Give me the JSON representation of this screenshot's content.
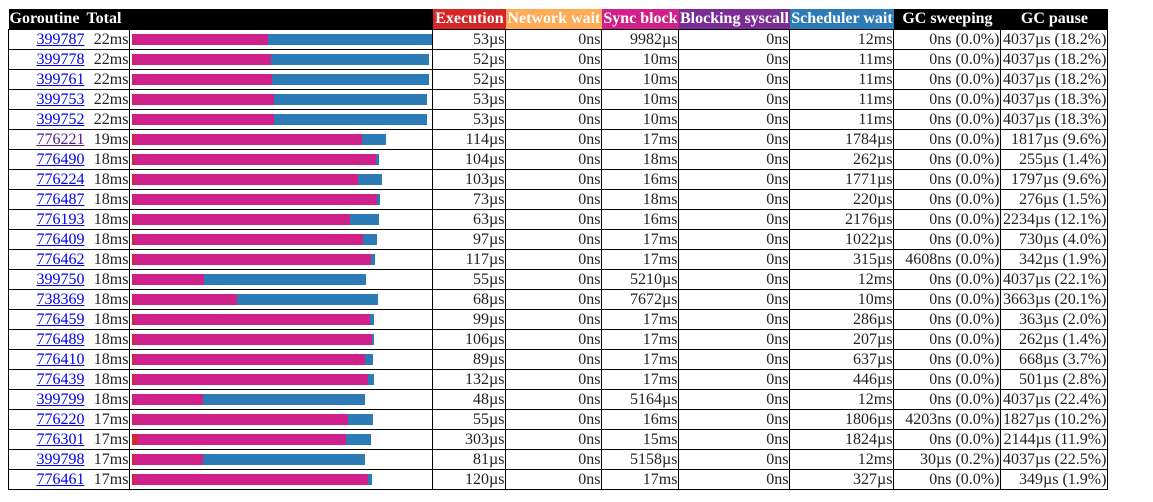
{
  "table": {
    "headers": {
      "goroutine": "Goroutine",
      "total": "Total",
      "execution": "Execution",
      "network_wait": "Network wait",
      "sync_block": "Sync block",
      "blocking_syscall": "Blocking syscall",
      "scheduler_wait": "Scheduler wait",
      "gc_sweeping": "GC sweeping",
      "gc_pause": "GC pause"
    },
    "colors": {
      "header_bg": "#000000",
      "execution": "#d62728",
      "network_wait": "#ffaa55",
      "sync_block": "#d0208a",
      "blocking_syscall": "#7b2d96",
      "scheduler_wait": "#2c7bb6",
      "link": "#0000ee",
      "link_visited": "#551a8b"
    },
    "rows": [
      {
        "id": "399787",
        "total": "22ms",
        "execution": "53µs",
        "network_wait": "0ns",
        "sync_block": "9982µs",
        "blocking_syscall": "0ns",
        "scheduler_wait": "12ms",
        "gc_sweeping": "0ns (0.0%)",
        "gc_pause": "4037µs (18.2%)",
        "visited": false
      },
      {
        "id": "399778",
        "total": "22ms",
        "execution": "52µs",
        "network_wait": "0ns",
        "sync_block": "10ms",
        "blocking_syscall": "0ns",
        "scheduler_wait": "11ms",
        "gc_sweeping": "0ns (0.0%)",
        "gc_pause": "4037µs (18.2%)",
        "visited": false
      },
      {
        "id": "399761",
        "total": "22ms",
        "execution": "52µs",
        "network_wait": "0ns",
        "sync_block": "10ms",
        "blocking_syscall": "0ns",
        "scheduler_wait": "11ms",
        "gc_sweeping": "0ns (0.0%)",
        "gc_pause": "4037µs (18.2%)",
        "visited": false
      },
      {
        "id": "399753",
        "total": "22ms",
        "execution": "53µs",
        "network_wait": "0ns",
        "sync_block": "10ms",
        "blocking_syscall": "0ns",
        "scheduler_wait": "11ms",
        "gc_sweeping": "0ns (0.0%)",
        "gc_pause": "4037µs (18.3%)",
        "visited": false
      },
      {
        "id": "399752",
        "total": "22ms",
        "execution": "53µs",
        "network_wait": "0ns",
        "sync_block": "10ms",
        "blocking_syscall": "0ns",
        "scheduler_wait": "11ms",
        "gc_sweeping": "0ns (0.0%)",
        "gc_pause": "4037µs (18.3%)",
        "visited": false
      },
      {
        "id": "776221",
        "total": "19ms",
        "execution": "114µs",
        "network_wait": "0ns",
        "sync_block": "17ms",
        "blocking_syscall": "0ns",
        "scheduler_wait": "1784µs",
        "gc_sweeping": "0ns (0.0%)",
        "gc_pause": "1817µs (9.6%)",
        "visited": true
      },
      {
        "id": "776490",
        "total": "18ms",
        "execution": "104µs",
        "network_wait": "0ns",
        "sync_block": "18ms",
        "blocking_syscall": "0ns",
        "scheduler_wait": "262µs",
        "gc_sweeping": "0ns (0.0%)",
        "gc_pause": "255µs (1.4%)",
        "visited": false
      },
      {
        "id": "776224",
        "total": "18ms",
        "execution": "103µs",
        "network_wait": "0ns",
        "sync_block": "16ms",
        "blocking_syscall": "0ns",
        "scheduler_wait": "1771µs",
        "gc_sweeping": "0ns (0.0%)",
        "gc_pause": "1797µs (9.6%)",
        "visited": false
      },
      {
        "id": "776487",
        "total": "18ms",
        "execution": "73µs",
        "network_wait": "0ns",
        "sync_block": "18ms",
        "blocking_syscall": "0ns",
        "scheduler_wait": "220µs",
        "gc_sweeping": "0ns (0.0%)",
        "gc_pause": "276µs (1.5%)",
        "visited": false
      },
      {
        "id": "776193",
        "total": "18ms",
        "execution": "63µs",
        "network_wait": "0ns",
        "sync_block": "16ms",
        "blocking_syscall": "0ns",
        "scheduler_wait": "2176µs",
        "gc_sweeping": "0ns (0.0%)",
        "gc_pause": "2234µs (12.1%)",
        "visited": false
      },
      {
        "id": "776409",
        "total": "18ms",
        "execution": "97µs",
        "network_wait": "0ns",
        "sync_block": "17ms",
        "blocking_syscall": "0ns",
        "scheduler_wait": "1022µs",
        "gc_sweeping": "0ns (0.0%)",
        "gc_pause": "730µs (4.0%)",
        "visited": false
      },
      {
        "id": "776462",
        "total": "18ms",
        "execution": "117µs",
        "network_wait": "0ns",
        "sync_block": "17ms",
        "blocking_syscall": "0ns",
        "scheduler_wait": "315µs",
        "gc_sweeping": "4608ns (0.0%)",
        "gc_pause": "342µs (1.9%)",
        "visited": false
      },
      {
        "id": "399750",
        "total": "18ms",
        "execution": "55µs",
        "network_wait": "0ns",
        "sync_block": "5210µs",
        "blocking_syscall": "0ns",
        "scheduler_wait": "12ms",
        "gc_sweeping": "0ns (0.0%)",
        "gc_pause": "4037µs (22.1%)",
        "visited": false
      },
      {
        "id": "738369",
        "total": "18ms",
        "execution": "68µs",
        "network_wait": "0ns",
        "sync_block": "7672µs",
        "blocking_syscall": "0ns",
        "scheduler_wait": "10ms",
        "gc_sweeping": "0ns (0.0%)",
        "gc_pause": "3663µs (20.1%)",
        "visited": false
      },
      {
        "id": "776459",
        "total": "18ms",
        "execution": "99µs",
        "network_wait": "0ns",
        "sync_block": "17ms",
        "blocking_syscall": "0ns",
        "scheduler_wait": "286µs",
        "gc_sweeping": "0ns (0.0%)",
        "gc_pause": "363µs (2.0%)",
        "visited": false
      },
      {
        "id": "776489",
        "total": "18ms",
        "execution": "106µs",
        "network_wait": "0ns",
        "sync_block": "17ms",
        "blocking_syscall": "0ns",
        "scheduler_wait": "207µs",
        "gc_sweeping": "0ns (0.0%)",
        "gc_pause": "262µs (1.4%)",
        "visited": false
      },
      {
        "id": "776410",
        "total": "18ms",
        "execution": "89µs",
        "network_wait": "0ns",
        "sync_block": "17ms",
        "blocking_syscall": "0ns",
        "scheduler_wait": "637µs",
        "gc_sweeping": "0ns (0.0%)",
        "gc_pause": "668µs (3.7%)",
        "visited": false
      },
      {
        "id": "776439",
        "total": "18ms",
        "execution": "132µs",
        "network_wait": "0ns",
        "sync_block": "17ms",
        "blocking_syscall": "0ns",
        "scheduler_wait": "446µs",
        "gc_sweeping": "0ns (0.0%)",
        "gc_pause": "501µs (2.8%)",
        "visited": false
      },
      {
        "id": "399799",
        "total": "18ms",
        "execution": "48µs",
        "network_wait": "0ns",
        "sync_block": "5164µs",
        "blocking_syscall": "0ns",
        "scheduler_wait": "12ms",
        "gc_sweeping": "0ns (0.0%)",
        "gc_pause": "4037µs (22.4%)",
        "visited": false
      },
      {
        "id": "776220",
        "total": "17ms",
        "execution": "55µs",
        "network_wait": "0ns",
        "sync_block": "16ms",
        "blocking_syscall": "0ns",
        "scheduler_wait": "1806µs",
        "gc_sweeping": "4203ns (0.0%)",
        "gc_pause": "1827µs (10.2%)",
        "visited": false
      },
      {
        "id": "776301",
        "total": "17ms",
        "execution": "303µs",
        "network_wait": "0ns",
        "sync_block": "15ms",
        "blocking_syscall": "0ns",
        "scheduler_wait": "1824µs",
        "gc_sweeping": "0ns (0.0%)",
        "gc_pause": "2144µs (11.9%)",
        "visited": false
      },
      {
        "id": "399798",
        "total": "17ms",
        "execution": "81µs",
        "network_wait": "0ns",
        "sync_block": "5158µs",
        "blocking_syscall": "0ns",
        "scheduler_wait": "12ms",
        "gc_sweeping": "30µs (0.2%)",
        "gc_pause": "4037µs (22.5%)",
        "visited": false
      },
      {
        "id": "776461",
        "total": "17ms",
        "execution": "120µs",
        "network_wait": "0ns",
        "sync_block": "17ms",
        "blocking_syscall": "0ns",
        "scheduler_wait": "327µs",
        "gc_sweeping": "0ns (0.0%)",
        "gc_pause": "349µs (1.9%)",
        "visited": false
      }
    ]
  },
  "chart_data": {
    "type": "bar",
    "stacked": true,
    "orientation": "horizontal",
    "unit": "µs",
    "categories": [
      "399787",
      "399778",
      "399761",
      "399753",
      "399752",
      "776221",
      "776490",
      "776224",
      "776487",
      "776193",
      "776409",
      "776462",
      "399750",
      "738369",
      "776459",
      "776489",
      "776410",
      "776439",
      "399799",
      "776220",
      "776301",
      "399798",
      "776461"
    ],
    "series": [
      {
        "name": "Execution",
        "color": "#d62728",
        "values": [
          53,
          52,
          52,
          53,
          53,
          114,
          104,
          103,
          73,
          63,
          97,
          117,
          55,
          68,
          99,
          106,
          89,
          132,
          48,
          55,
          303,
          81,
          120
        ]
      },
      {
        "name": "Network wait",
        "color": "#ffaa55",
        "values": [
          0,
          0,
          0,
          0,
          0,
          0,
          0,
          0,
          0,
          0,
          0,
          0,
          0,
          0,
          0,
          0,
          0,
          0,
          0,
          0,
          0,
          0,
          0
        ]
      },
      {
        "name": "Sync block",
        "color": "#d0208a",
        "values": [
          9982,
          10200,
          10250,
          10400,
          10400,
          16900,
          17900,
          16600,
          18000,
          16000,
          17000,
          17500,
          5210,
          7672,
          17500,
          17600,
          17100,
          17300,
          5164,
          15900,
          15500,
          5158,
          17300
        ]
      },
      {
        "name": "Blocking syscall",
        "color": "#7b2d96",
        "values": [
          0,
          0,
          0,
          0,
          0,
          0,
          0,
          0,
          0,
          0,
          0,
          0,
          0,
          0,
          0,
          0,
          0,
          0,
          0,
          0,
          0,
          0,
          0
        ]
      },
      {
        "name": "Scheduler wait",
        "color": "#2c7bb6",
        "values": [
          12100,
          11700,
          11600,
          11300,
          11300,
          1784,
          262,
          1771,
          220,
          2176,
          1022,
          315,
          12000,
          10400,
          286,
          207,
          637,
          446,
          12000,
          1806,
          1824,
          12000,
          327
        ]
      }
    ],
    "xlim": [
      0,
      22200
    ]
  }
}
